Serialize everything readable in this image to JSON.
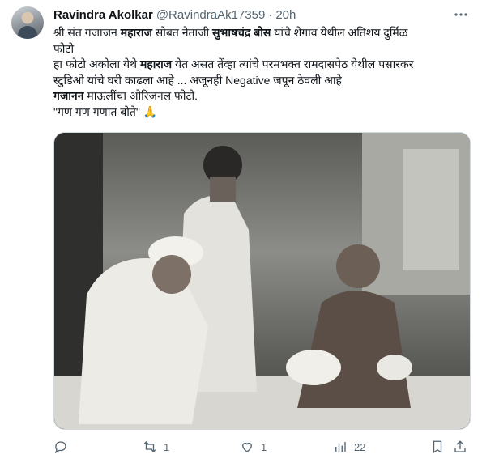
{
  "tweet": {
    "author_name": "Ravindra Akolkar",
    "handle": "@RavindraAk17359",
    "separator": "·",
    "time": "20h",
    "more_icon": "more-dots-icon",
    "lines": [
      [
        {
          "t": "श्री संत गजाजन "
        },
        {
          "t": "महाराज",
          "b": true
        },
        {
          "t": " सोबत नेताजी "
        },
        {
          "t": "सुभाषचंद्र बोस",
          "b": true
        },
        {
          "t": " यांचे शेगाव येथील अतिशय दुर्मिळ"
        }
      ],
      [
        {
          "t": "फोटो"
        }
      ],
      [
        {
          "t": "हा फोटो अकोला येथे "
        },
        {
          "t": "महाराज",
          "b": true
        },
        {
          "t": " येत असत तेंव्हा त्यांचे परमभक्त रामदासपेठ येथील पसारकर"
        }
      ],
      [
        {
          "t": "स्टुडिओ यांचे घरी काढला आहे ... अजूनही Negative जपून ठेवली आहे"
        }
      ],
      [
        {
          "t": " "
        },
        {
          "t": "गजानन",
          "b": true
        },
        {
          "t": " माऊलींचा ओरिजनल फोटो."
        }
      ],
      [
        {
          "t": "\"गण गण गणात बोते\" 🙏"
        }
      ]
    ]
  },
  "actions": {
    "reply_count": "",
    "retweet_count": "1",
    "like_count": "1",
    "views_count": "22"
  }
}
